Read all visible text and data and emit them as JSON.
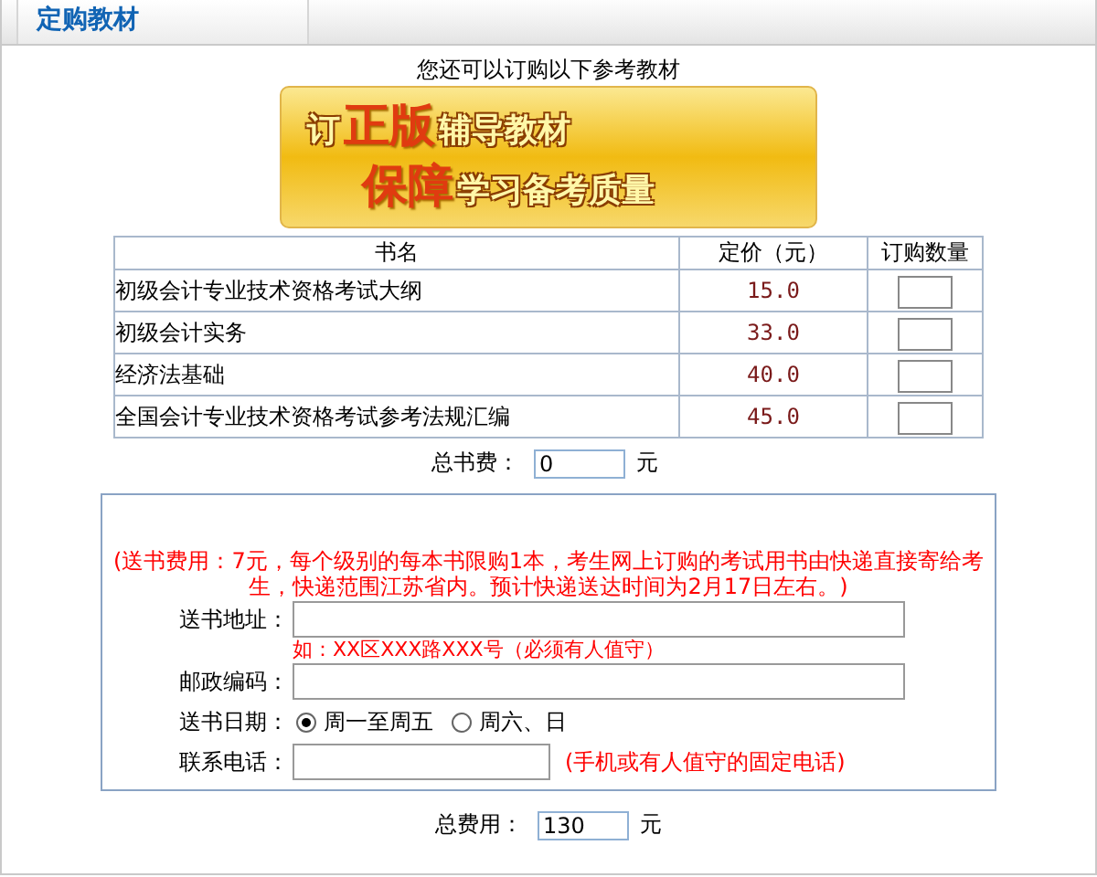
{
  "header": {
    "title": "定购教材"
  },
  "intro": "您还可以订购以下参考教材",
  "banner": {
    "lines": [
      [
        {
          "text": "订",
          "kind": "plain"
        },
        {
          "text": "正版",
          "kind": "emphasis"
        },
        {
          "text": "辅导教材",
          "kind": "plain"
        }
      ],
      [
        {
          "text": "保障",
          "kind": "emphasis"
        },
        {
          "text": "学习备考质量",
          "kind": "plain"
        }
      ]
    ]
  },
  "table": {
    "columns": [
      "书名",
      "定价（元）",
      "订购数量"
    ],
    "rows": [
      {
        "name": "初级会计专业技术资格考试大纲",
        "price": "15.0"
      },
      {
        "name": "初级会计实务",
        "price": "33.0"
      },
      {
        "name": "经济法基础",
        "price": "40.0"
      },
      {
        "name": "全国会计专业技术资格考试参考法规汇编",
        "price": "45.0"
      }
    ]
  },
  "book_total": {
    "label": "总书费：",
    "value": "0",
    "unit": "元"
  },
  "shipping": {
    "notice": "(送书费用：7元，每个级别的每本书限购1本，考生网上订购的考试用书由快递直接寄给考生，快递范围江苏省内。预计快递送达时间为2月17日左右。)",
    "fields": [
      {
        "kind": "wide_text",
        "label": "送书地址：",
        "hint": "如：XX区XXX路XXX号（必须有人值守）"
      },
      {
        "kind": "wide_text",
        "label": "邮政编码："
      },
      {
        "kind": "radio",
        "label": "送书日期：",
        "options": [
          {
            "label": "周一至周五",
            "selected": true
          },
          {
            "label": "周六、日",
            "selected": false
          }
        ]
      },
      {
        "kind": "short_text",
        "label": "联系电话：",
        "note": "(手机或有人值守的固定电话)"
      }
    ]
  },
  "grand_total": {
    "label": "总费用：",
    "value": "130",
    "unit": "元"
  }
}
